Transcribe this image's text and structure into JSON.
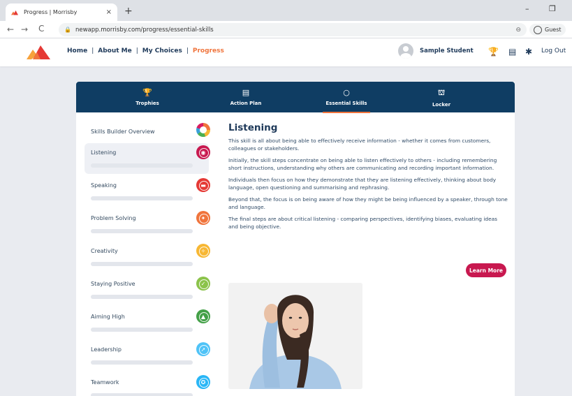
{
  "browser": {
    "tab_title": "Progress | Morrisby",
    "tab_close": "×",
    "new_tab": "+",
    "url": "newapp.morrisby.com/progress/essential-skills",
    "profile": "Guest",
    "nav_back": "←",
    "nav_forward": "→",
    "nav_reload": "C",
    "zoom_icon": "⊖",
    "win_minimize": "–",
    "win_restore": "❐"
  },
  "header": {
    "nav": [
      "Home",
      "About Me",
      "My Choices",
      "Progress"
    ],
    "separator": "|",
    "active_nav": "Progress",
    "user_name": "Sample Student",
    "logout": "Log Out",
    "icons": {
      "trophy": "🏆",
      "document": "▤",
      "settings": "✱"
    }
  },
  "subnav": {
    "tabs": [
      {
        "label": "Trophies",
        "icon": "🏆"
      },
      {
        "label": "Action Plan",
        "icon": "▤"
      },
      {
        "label": "Essential Skills",
        "icon": "○"
      },
      {
        "label": "Locker",
        "icon": "⛫"
      }
    ],
    "active": "Essential Skills"
  },
  "skills": [
    {
      "label": "Skills Builder Overview",
      "color": "#f0743c",
      "glyph": ""
    },
    {
      "label": "Listening",
      "color": "#c8184f",
      "glyph": "◉"
    },
    {
      "label": "Speaking",
      "color": "#e53935",
      "glyph": "▬"
    },
    {
      "label": "Problem Solving",
      "color": "#f0743c",
      "glyph": "✦"
    },
    {
      "label": "Creativity",
      "color": "#f7b733",
      "glyph": "✧"
    },
    {
      "label": "Staying Positive",
      "color": "#8bc34a",
      "glyph": "✓"
    },
    {
      "label": "Aiming High",
      "color": "#43a047",
      "glyph": "▲"
    },
    {
      "label": "Leadership",
      "color": "#4fc3f7",
      "glyph": "➚"
    },
    {
      "label": "Teamwork",
      "color": "#29b6f6",
      "glyph": "✪"
    }
  ],
  "selected_skill": "Listening",
  "article": {
    "title": "Listening",
    "paragraphs": [
      "This skill is all about being able to effectively receive information - whether it comes from customers, colleagues or stakeholders.",
      "Initially, the skill steps concentrate on being able to listen effectively to others - including remembering short instructions, understanding why others are communicating and recording important information.",
      "Individuals then focus on how they demonstrate that they are listening effectively, thinking about body language, open questioning and summarising and rephrasing.",
      "Beyond that, the focus is on being aware of how they might be being influenced by a speaker, through tone and language.",
      "The final steps are about critical listening - comparing perspectives, identifying biases, evaluating ideas and being objective."
    ],
    "learn_more": "Learn More"
  },
  "colors": {
    "navy": "#0f3d63",
    "accent_orange": "#f0743c",
    "button_red": "#c8184f",
    "page_bg": "#e9ebf0"
  }
}
